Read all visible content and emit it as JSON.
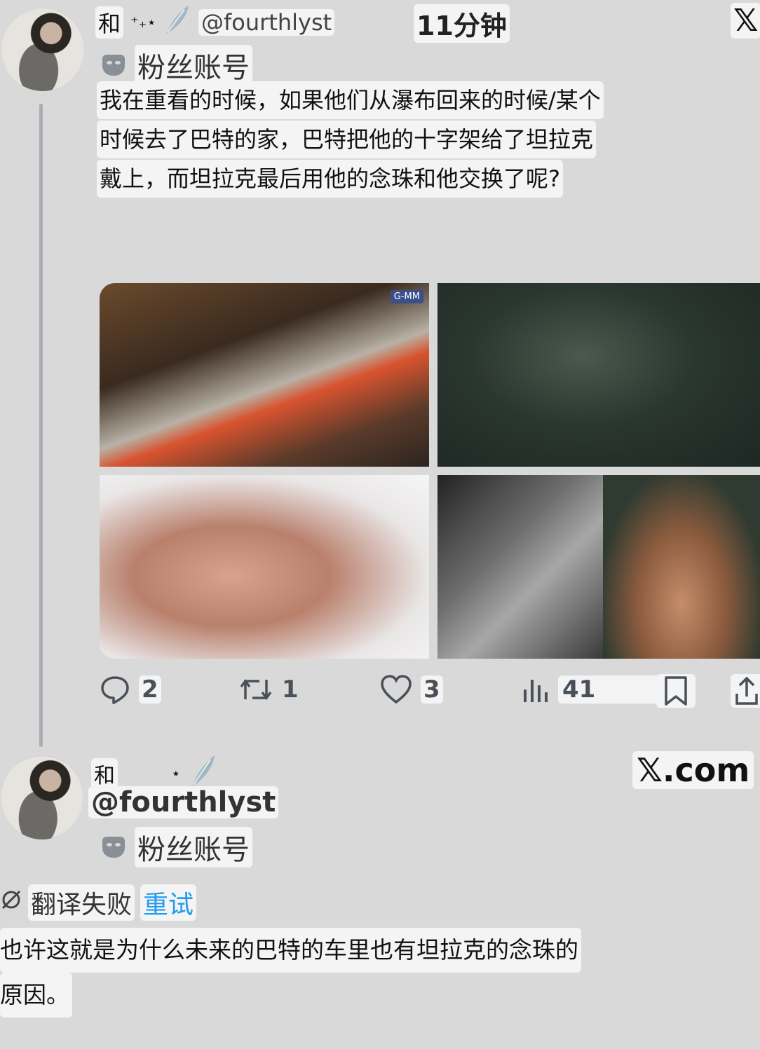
{
  "tweet": {
    "name_char": "和",
    "name_deco": "⁺₊⋆",
    "handle": "@fourthlyst",
    "time": "11分钟",
    "platform_logo": "𝕏",
    "badge_label": "粉丝账号",
    "text_lines": [
      "我在重看的时候，如果他们从瀑布回来的时候/某个",
      "时候去了巴特的家，巴特把他的十字架给了坦拉克",
      "戴上，而坦拉克最后用他的念珠和他交换了呢?"
    ],
    "media_tag": "G-MM",
    "actions": {
      "replies": "2",
      "retweets": "1",
      "likes": "3",
      "views": "41"
    }
  },
  "reply": {
    "name_char": "和",
    "name_deco": "⋆",
    "handle": "@fourthlyst",
    "site": "𝕏.com",
    "badge_label": "粉丝账号",
    "translation_failed": "翻译失败",
    "retry": "重试",
    "text_lines": [
      "也许这就是为什么未来的巴特的车里也有坦拉克的念珠的",
      "原因。"
    ]
  }
}
